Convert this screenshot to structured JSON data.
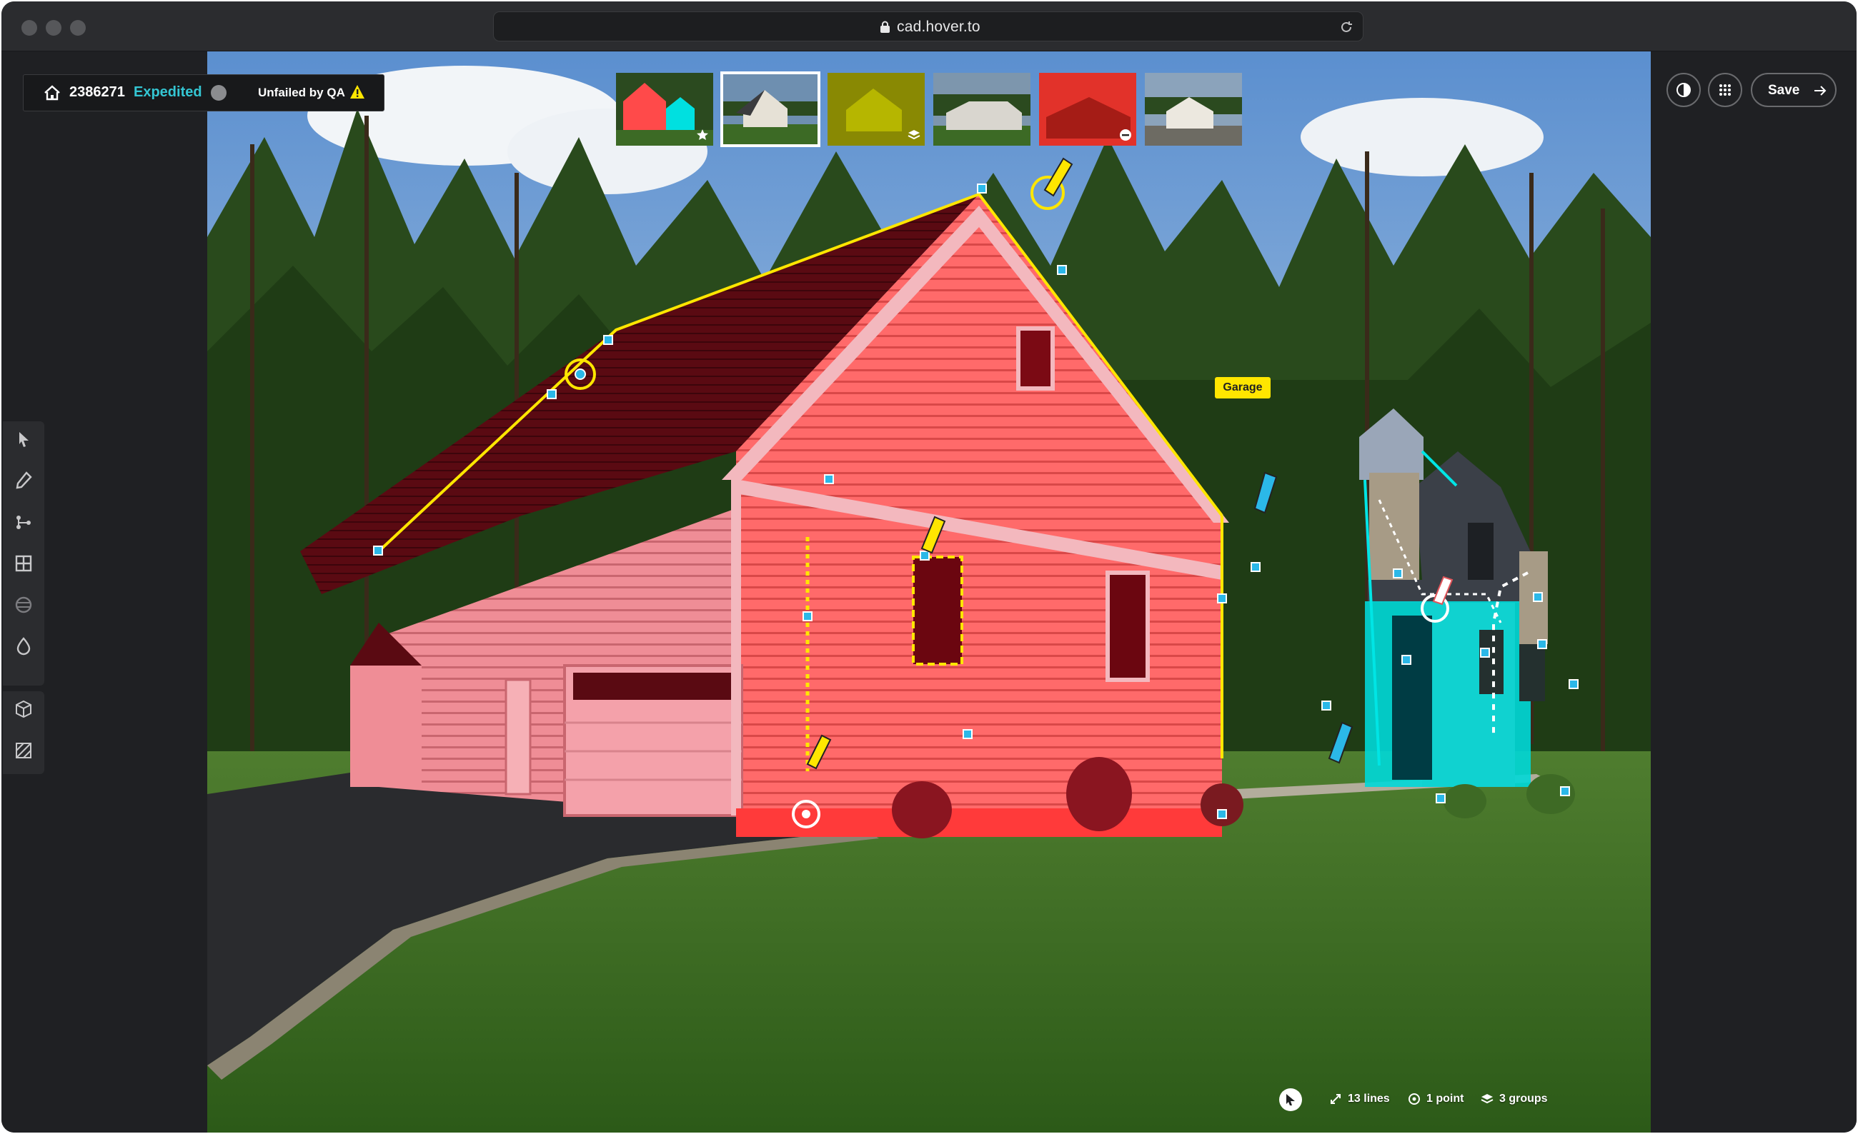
{
  "browser": {
    "url": "cad.hover.to"
  },
  "job": {
    "id": "2386271",
    "priority": "Expedited",
    "qa_status": "Unfailed by QA"
  },
  "toolbar": {
    "save_label": "Save"
  },
  "thumbnails": [
    {
      "name": "thumb-segmentation",
      "badge": "star-icon"
    },
    {
      "name": "thumb-photo-1",
      "selected": true
    },
    {
      "name": "thumb-yellow-overlay",
      "badge": "layers-icon"
    },
    {
      "name": "thumb-photo-2"
    },
    {
      "name": "thumb-red-overlay",
      "badge": "minus-icon"
    },
    {
      "name": "thumb-photo-3"
    }
  ],
  "annotations": {
    "facade_label": "Garage"
  },
  "status": {
    "lines": "13 lines",
    "points": "1 point",
    "groups": "3 groups"
  },
  "tools": [
    "select-icon",
    "pen-icon",
    "node-icon",
    "grid-icon",
    "globe-icon",
    "drop-icon",
    "cube-icon",
    "hatch-icon"
  ],
  "colors": {
    "accent": "#34c6d3",
    "warning": "#ffe600",
    "facade_red": "#ff5a5a",
    "facade_cyan": "#00e5e5"
  }
}
